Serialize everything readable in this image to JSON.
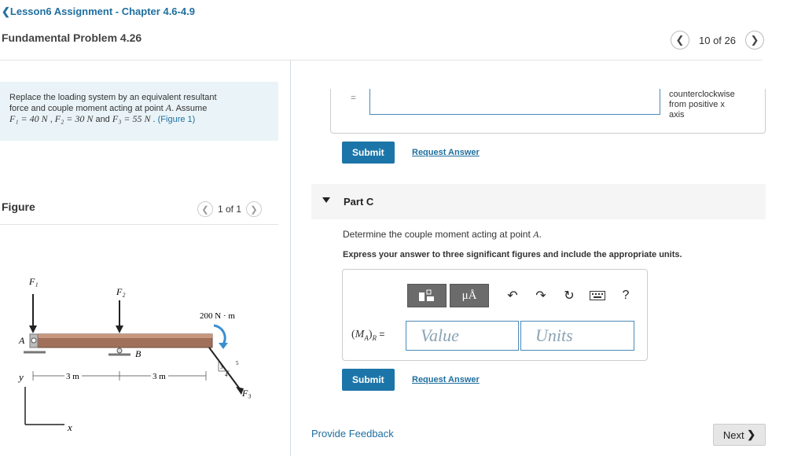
{
  "header": {
    "back_label": "Lesson6 Assignment - Chapter 4.6-4.9",
    "problem_title": "Fundamental Problem 4.26",
    "pager_text": "10 of 26"
  },
  "prompt": {
    "line1": "Replace the loading system by an equivalent resultant",
    "line2a": "force and couple moment acting at point ",
    "point": "A",
    "line2b": ". Assume",
    "f1": "F₁ = 40 N",
    "f2": "F₂ = 30 N",
    "and": " and ",
    "f3": "F₃ = 55 N",
    "sep": " , ",
    "figure_link": "(Figure 1)"
  },
  "figure": {
    "title": "Figure",
    "pager_text": "1 of 1",
    "labels": {
      "f1": "F₁",
      "f2": "F₂",
      "f3": "F₃",
      "a": "A",
      "b": "B",
      "moment": "200 N · m",
      "dist1": "3 m",
      "dist2": "3 m",
      "y": "y",
      "x": "x",
      "tri3": "3",
      "tri4": "4",
      "tri5": "5"
    }
  },
  "partB": {
    "label_fragment": "=",
    "ccw_line1": "counterclockwise",
    "ccw_line2": "from positive x",
    "ccw_line3": "axis",
    "submit": "Submit",
    "request": "Request Answer"
  },
  "partC": {
    "label": "Part C",
    "question_a": "Determine the couple moment acting at point ",
    "question_point": "A",
    "question_b": ".",
    "instruction": "Express your answer to three significant figures and include the appropriate units.",
    "toolbar": {
      "mu_label": "μÅ",
      "help": "?"
    },
    "answer_label": "(M_A)_R =",
    "value_placeholder": "Value",
    "units_placeholder": "Units",
    "submit": "Submit",
    "request": "Request Answer"
  },
  "footer": {
    "feedback": "Provide Feedback",
    "next": "Next"
  },
  "colors": {
    "accent": "#1c75a8",
    "link": "#1f6f9f",
    "prompt_bg": "#eaf4f8",
    "beam": "#a0705a"
  }
}
